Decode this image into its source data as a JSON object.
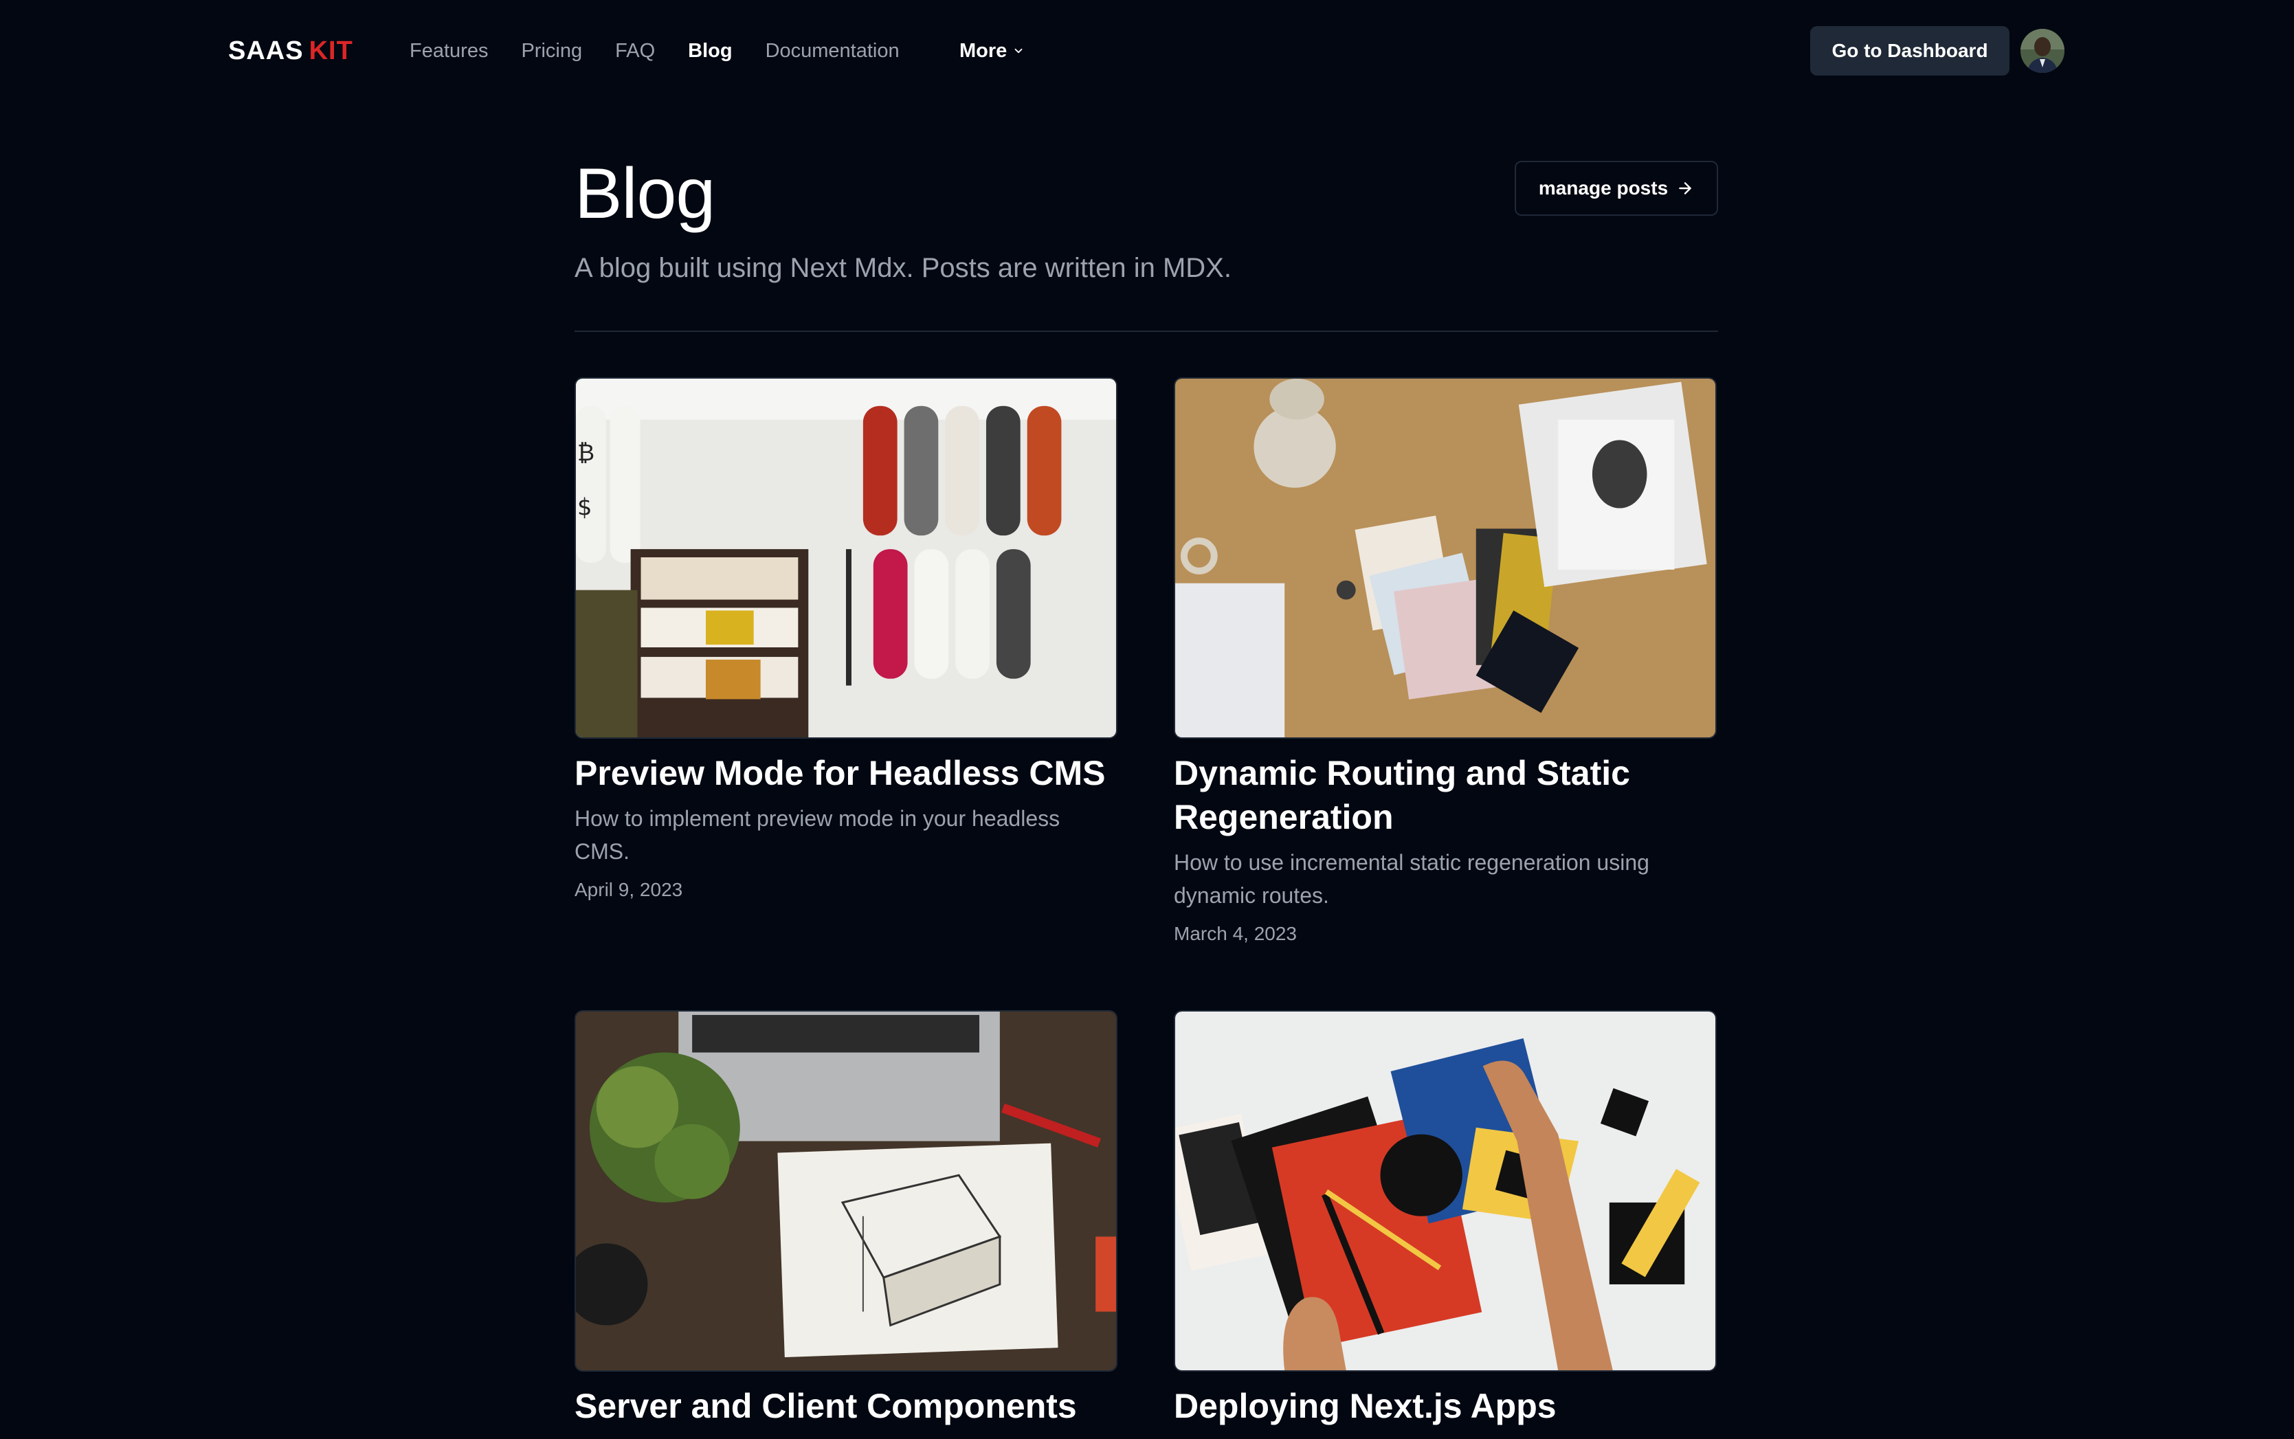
{
  "brand": {
    "part1": "SAAS",
    "part2": "KIT"
  },
  "nav": {
    "items": [
      "Features",
      "Pricing",
      "FAQ",
      "Blog",
      "Documentation"
    ],
    "active": "Blog",
    "more_label": "More"
  },
  "header": {
    "dashboard_button": "Go to Dashboard"
  },
  "page": {
    "title": "Blog",
    "subtitle": "A blog built using Next Mdx. Posts are written in MDX.",
    "manage_button": "manage posts"
  },
  "posts": [
    {
      "title": "Preview Mode for Headless CMS",
      "description": "How to implement preview mode in your headless CMS.",
      "date": "April 9, 2023"
    },
    {
      "title": "Dynamic Routing and Static Regeneration",
      "description": "How to use incremental static regeneration using dynamic routes.",
      "date": "March 4, 2023"
    },
    {
      "title": "Server and Client Components",
      "description": "",
      "date": ""
    },
    {
      "title": "Deploying Next.js Apps",
      "description": "",
      "date": ""
    }
  ],
  "colors": {
    "background": "#030711",
    "brand_accent": "#dc2626",
    "muted_text": "#9ca3af",
    "button_bg": "#1f2937"
  }
}
